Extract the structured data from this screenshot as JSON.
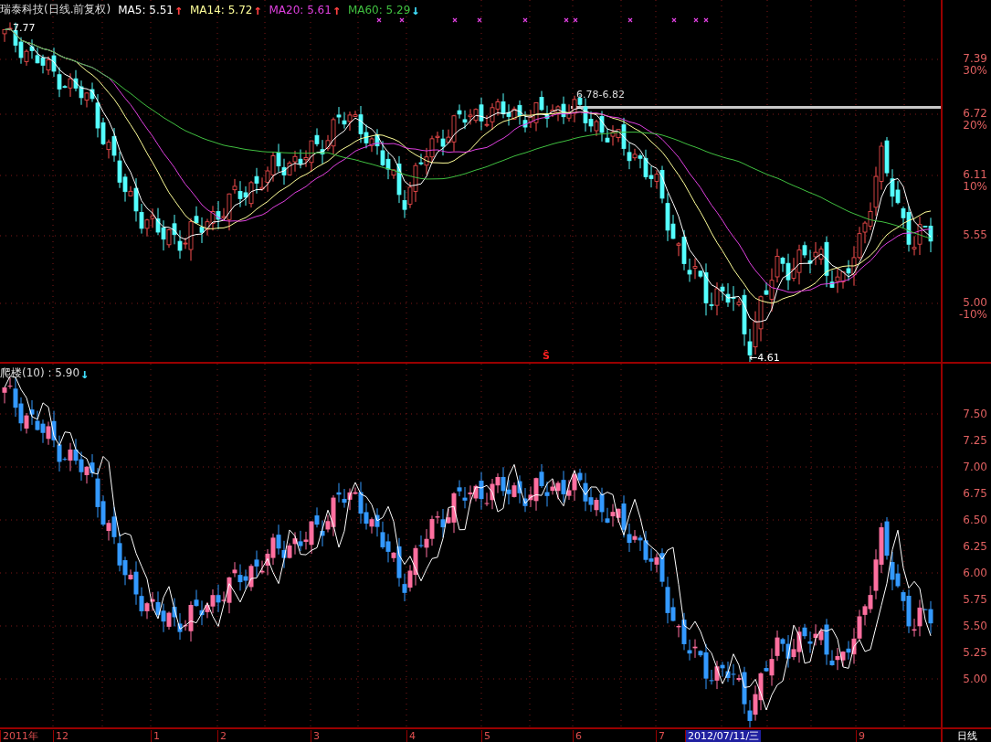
{
  "top_pane": {
    "title": "瑞泰科技(日线.前复权)",
    "moving_averages": [
      {
        "label": "MA5: 5.51",
        "color": "#ffffff",
        "arrow": {
          "symbol": "↑",
          "color": "#ff4040"
        }
      },
      {
        "label": "MA14: 5.72",
        "color": "#ffff99",
        "arrow": {
          "symbol": "↑",
          "color": "#ff4040"
        }
      },
      {
        "label": "MA20: 5.61",
        "color": "#e040e0",
        "arrow": {
          "symbol": "↑",
          "color": "#ff4040"
        }
      },
      {
        "label": "MA60: 5.29",
        "color": "#40c040",
        "arrow": {
          "symbol": "↓",
          "color": "#40e0ff"
        }
      }
    ],
    "high_label": "7.77",
    "range_label": "6.78-6.82",
    "low_label": "←4.61",
    "signal_mark": "Ŝ",
    "axis_labels": [
      {
        "price": "7.39",
        "percent": "30%"
      },
      {
        "price": "6.72",
        "percent": "20%"
      },
      {
        "price": "6.11",
        "percent": "10%"
      },
      {
        "price": "5.55"
      },
      {
        "price": "5.00",
        "percent": "-10%"
      }
    ]
  },
  "bottom_pane": {
    "title": "爬楼(10) : 5.90",
    "arrow": {
      "symbol": "↓",
      "color": "#40e0ff"
    },
    "axis_labels": [
      "7.50",
      "7.25",
      "7.00",
      "6.75",
      "6.50",
      "6.25",
      "6.00",
      "5.75",
      "5.50",
      "5.25",
      "5.00"
    ]
  },
  "time_axis": {
    "labels": [
      {
        "text": "2011年",
        "selected": false
      },
      {
        "text": "12",
        "selected": false
      },
      {
        "text": "1",
        "selected": false
      },
      {
        "text": "2",
        "selected": false
      },
      {
        "text": "3",
        "selected": false
      },
      {
        "text": "4",
        "selected": false
      },
      {
        "text": "5",
        "selected": false
      },
      {
        "text": "6",
        "selected": false
      },
      {
        "text": "7",
        "selected": false
      },
      {
        "text": "2012/07/11/三",
        "selected": true
      },
      {
        "text": "9",
        "selected": false
      }
    ],
    "period": "日线"
  }
}
